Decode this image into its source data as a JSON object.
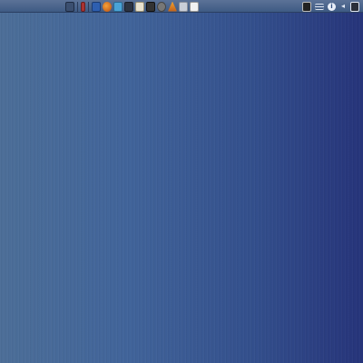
{
  "desktop": {
    "background_colors": [
      "#4c6e98",
      "#26347a"
    ],
    "panel_color": "#4a6790"
  },
  "launcher_icons": [
    "trash-icon",
    "red-flag-icon",
    "blue-app-icon",
    "firefox-icon",
    "sky-app-icon",
    "terminal-icon",
    "document-icon",
    "dark-app-icon",
    "settings-gear-icon",
    "vlc-cone-icon",
    "tools-icon",
    "mail-icon"
  ],
  "tray_icons": [
    "display-terminal-icon",
    "menu-lines-icon",
    "info-icon",
    "volume-icon",
    "monitor-icon"
  ]
}
